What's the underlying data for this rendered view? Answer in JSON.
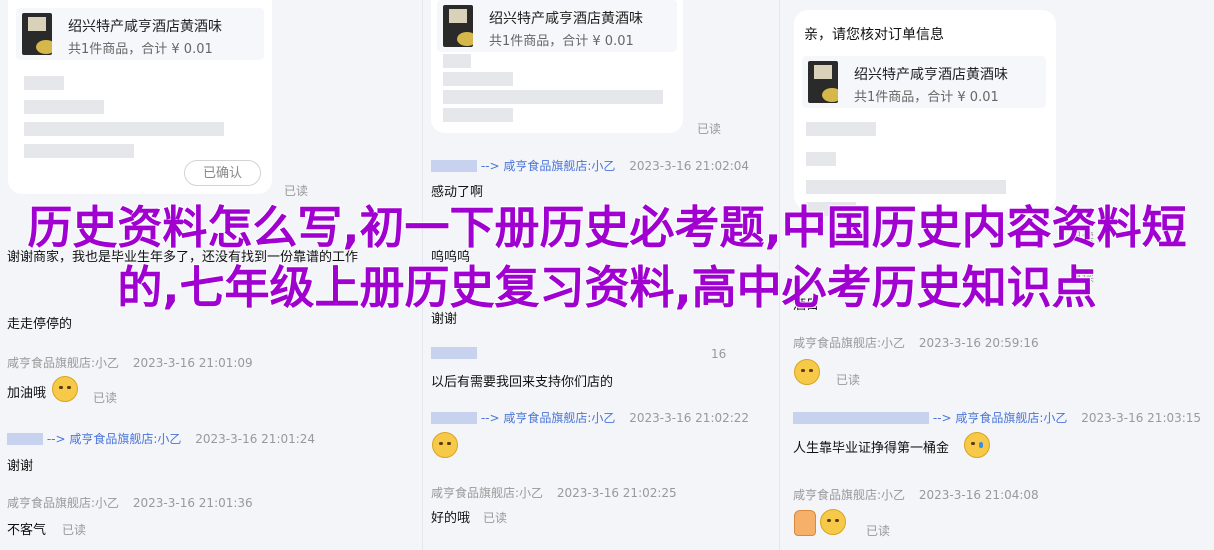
{
  "product": {
    "name": "绍兴特产咸亨酒店黄酒味",
    "info": "共1件商品，合计 ¥ 0.01"
  },
  "common": {
    "read": "已读",
    "confirmed": "已确认",
    "arrow": "-->"
  },
  "col_c_header": "亲，请您核对订单信息",
  "overlay_title": "历史资料怎么写,初一下册历史必考题,中国历史内容资料短的,七年级上册历史复习资料,高中必考历史知识点",
  "col_a": {
    "messages": [
      {
        "text": "谢谢商家，我也是毕业生年多了，还没有找到一份靠谱的工作"
      },
      {
        "text": "走走停停的"
      },
      {
        "sender": "咸亨食品旗舰店:小乙",
        "time": "2023-3-16 21:01:09",
        "text": "加油哦"
      },
      {
        "target": "咸亨食品旗舰店:小乙",
        "time": "2023-3-16 21:01:24",
        "text": "谢谢"
      },
      {
        "sender": "咸亨食品旗舰店:小乙",
        "time": "2023-3-16 21:01:36",
        "text": "不客气"
      }
    ]
  },
  "col_b": {
    "messages": [
      {
        "target": "咸亨食品旗舰店:小乙",
        "time": "2023-3-16 21:02:04",
        "text": "感动了啊"
      },
      {
        "text": "呜呜呜"
      },
      {
        "text": "谢谢"
      },
      {
        "time_partial": "16",
        "text": "以后有需要我回来支持你们店的"
      },
      {
        "target": "咸亨食品旗舰店:小乙",
        "time": "2023-3-16 21:02:22",
        "text": ""
      },
      {
        "sender": "咸亨食品旗舰店:小乙",
        "time": "2023-3-16 21:02:25",
        "text": "好的哦"
      }
    ]
  },
  "col_c": {
    "messages": [
      {
        "text": "酒目"
      },
      {
        "sender": "咸亨食品旗舰店:小乙",
        "time": "2023-3-16 20:59:16",
        "text": ""
      },
      {
        "target": "咸亨食品旗舰店:小乙",
        "time": "2023-3-16 21:03:15",
        "text": "人生靠毕业证挣得第一桶金"
      },
      {
        "sender": "咸亨食品旗舰店:小乙",
        "time": "2023-3-16 21:04:08",
        "text": ""
      }
    ]
  }
}
